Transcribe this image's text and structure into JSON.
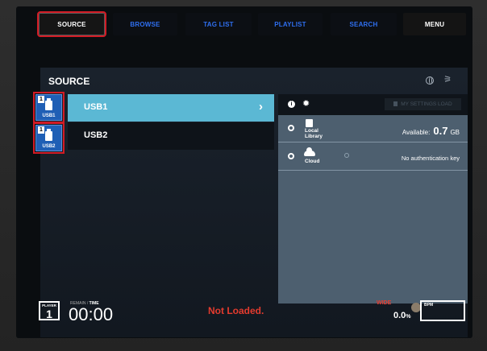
{
  "tabs": [
    {
      "label": "SOURCE",
      "selected": true
    },
    {
      "label": "BROWSE"
    },
    {
      "label": "TAG LIST"
    },
    {
      "label": "PLAYLIST"
    },
    {
      "label": "SEARCH"
    },
    {
      "label": "MENU"
    }
  ],
  "source": {
    "title": "SOURCE",
    "slots": [
      {
        "number": "1",
        "label": "USB1"
      },
      {
        "number": "1",
        "label": "USB2"
      }
    ],
    "devices": [
      {
        "label": "USB1",
        "selected": true
      },
      {
        "label": "USB2"
      }
    ]
  },
  "panel": {
    "my_settings_label": "MY SETTINGS LOAD",
    "locations": [
      {
        "name_line1": "Local",
        "name_line2": "Library",
        "available_label": "Available:",
        "available_value": "0.7",
        "available_unit": "GB"
      },
      {
        "name_line1": "Cloud",
        "status": "No authentication key"
      }
    ]
  },
  "status": {
    "player_label": "PLAYER",
    "player_number": "1",
    "remain_label": "REMAIN",
    "time_label": "TIME",
    "time_value": "00:00",
    "load_status": "Not Loaded.",
    "wide_label": "WIDE",
    "pitch_value": "0.0",
    "pitch_unit": "%",
    "bpm_label": "BPM"
  },
  "colors": {
    "accent_blue": "#2f6ff0",
    "selected_row": "#5bb8d4",
    "alert_red": "#e53b2e",
    "highlight_outline": "#d21b25"
  }
}
